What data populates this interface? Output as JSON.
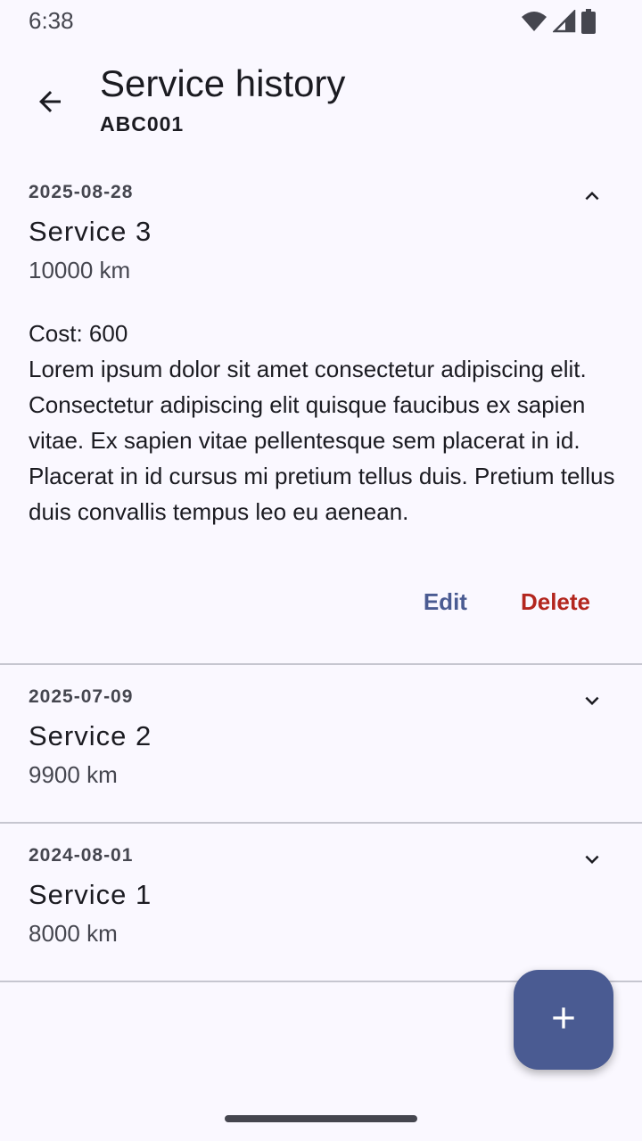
{
  "status_bar": {
    "time": "6:38",
    "icons": [
      "wifi-icon",
      "cellular-signal-icon",
      "battery-icon"
    ]
  },
  "app_bar": {
    "title": "Service history",
    "subtitle": "ABC001",
    "back_icon": "arrow-back-icon"
  },
  "services": [
    {
      "date": "2025-08-28",
      "name": "Service 3",
      "odometer": "10000 km",
      "expanded": true,
      "cost": "Cost: 600",
      "description": "Lorem ipsum dolor sit amet consectetur adipiscing elit. Consectetur adipiscing elit quisque faucibus ex sapien vitae. Ex sapien vitae pellentesque sem placerat in id. Placerat in id cursus mi pretium tellus duis. Pretium tellus duis convallis tempus leo eu aenean.",
      "edit_label": "Edit",
      "delete_label": "Delete"
    },
    {
      "date": "2025-07-09",
      "name": "Service 2",
      "odometer": "9900 km",
      "expanded": false
    },
    {
      "date": "2024-08-01",
      "name": "Service 1",
      "odometer": "8000 km",
      "expanded": false
    }
  ],
  "fab": {
    "icon": "add-icon"
  },
  "colors": {
    "primary": "#4a5b92",
    "error": "#b3261e",
    "background": "#faf8ff"
  }
}
